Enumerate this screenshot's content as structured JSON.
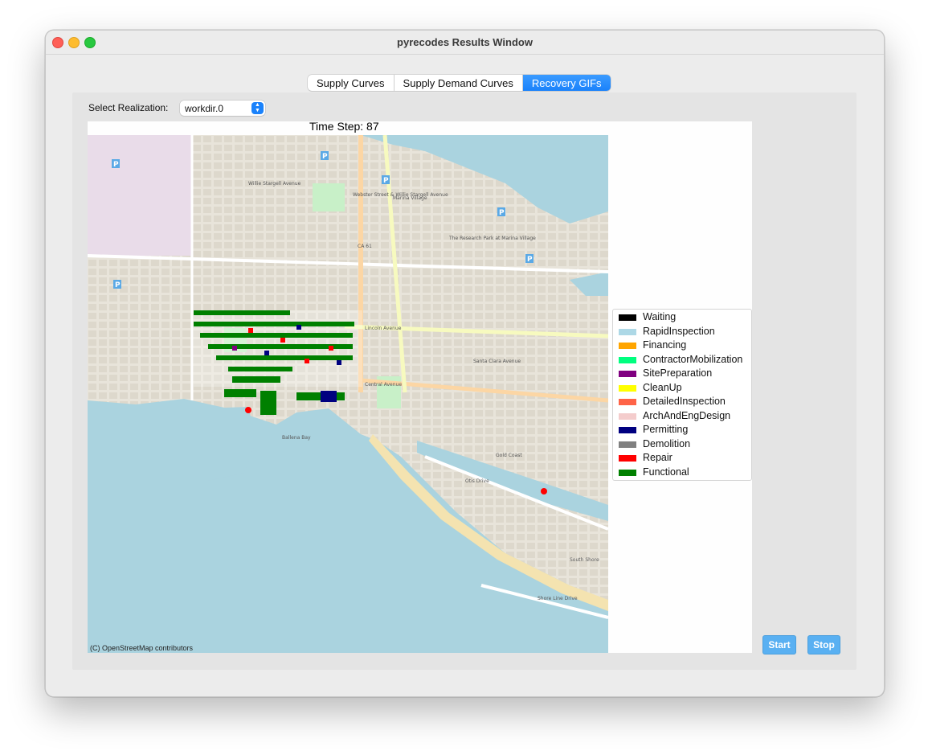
{
  "window": {
    "title": "pyrecodes Results Window"
  },
  "tabs": [
    {
      "label": "Supply Curves",
      "active": false
    },
    {
      "label": "Supply Demand Curves",
      "active": false
    },
    {
      "label": "Recovery GIFs",
      "active": true
    }
  ],
  "controls": {
    "realization_label": "Select Realization:",
    "realization_value": "workdir.0",
    "start_label": "Start",
    "stop_label": "Stop"
  },
  "figure": {
    "time_step_label": "Time Step: 87",
    "attribution": "(C) OpenStreetMap contributors"
  },
  "legend": [
    {
      "label": "Waiting",
      "color": "#000000"
    },
    {
      "label": "RapidInspection",
      "color": "#add8e6"
    },
    {
      "label": "Financing",
      "color": "#ffa500"
    },
    {
      "label": "ContractorMobilization",
      "color": "#00ff7f"
    },
    {
      "label": "SitePreparation",
      "color": "#800080"
    },
    {
      "label": "CleanUp",
      "color": "#ffff00"
    },
    {
      "label": "DetailedInspection",
      "color": "#ff6347"
    },
    {
      "label": "ArchAndEngDesign",
      "color": "#f4cccc"
    },
    {
      "label": "Permitting",
      "color": "#000080"
    },
    {
      "label": "Demolition",
      "color": "#808080"
    },
    {
      "label": "Repair",
      "color": "#ff0000"
    },
    {
      "label": "Functional",
      "color": "#008000"
    }
  ],
  "map": {
    "labels": [
      "Webster Street & Willie Stargell Avenue",
      "Willie Stargell Avenue",
      "Lincoln Avenue",
      "Central Avenue",
      "Santa Clara Avenue",
      "Otis Drive",
      "Shore Line Drive",
      "Ballena Bay",
      "Gold Coast",
      "South Shore",
      "The Research Park at Marina Village",
      "Marina Village",
      "CA 61"
    ]
  }
}
